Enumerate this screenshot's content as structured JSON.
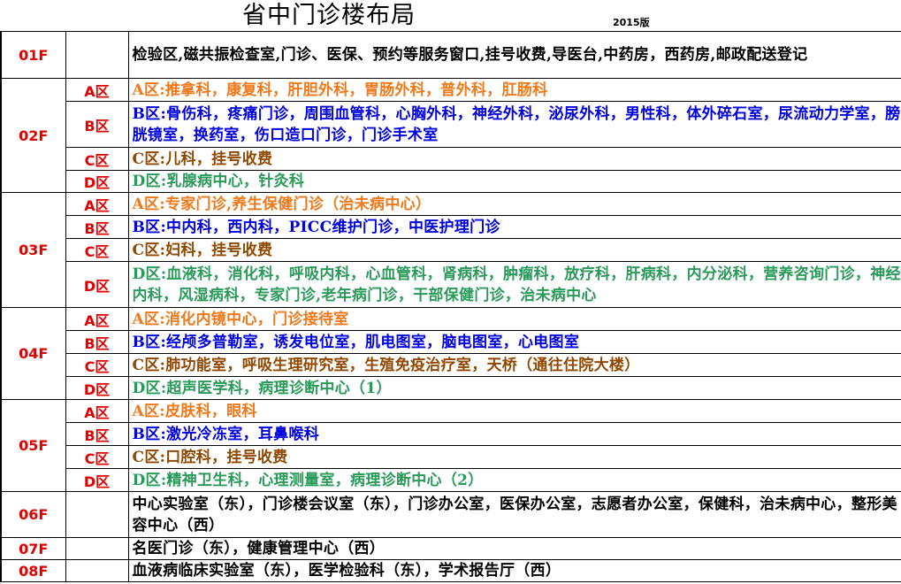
{
  "header": {
    "title": "省中门诊楼布局",
    "version": "2015版"
  },
  "floors": {
    "f01": {
      "label": "01F",
      "desc": "检验区,磁共振检查室,门诊、医保、预约等服务窗口,挂号收费,导医台,中药房，西药房,邮政配送登记"
    },
    "f02": {
      "label": "02F",
      "a": {
        "zone": "A区",
        "desc": "A区:推拿科，康复科，肝胆外科，胃肠外科，普外科，肛肠科"
      },
      "b": {
        "zone": "B区",
        "desc": "B区:骨伤科，疼痛门诊，周围血管科，心胸外科，神经外科，泌尿外科，男性科，体外碎石室，尿流动力学室，膀胱镜室，换药室，伤口造口门诊，门诊手术室"
      },
      "c": {
        "zone": "C区",
        "desc": "C区:儿科，挂号收费"
      },
      "d": {
        "zone": "D区",
        "desc": "D区:乳腺病中心，针灸科"
      }
    },
    "f03": {
      "label": "03F",
      "a": {
        "zone": "A区",
        "desc": "A区:专家门诊,养生保健门诊（治未病中心）"
      },
      "b": {
        "zone": "B区",
        "desc": "B区:中内科，西内科，PICC维护门诊，中医护理门诊"
      },
      "c": {
        "zone": "C区",
        "desc": "C区:妇科，挂号收费"
      },
      "d": {
        "zone": "D区",
        "desc": "D区:血液科，消化科，呼吸内科，心血管科，肾病科，肿瘤科，放疗科，肝病科，内分泌科，营养咨询门诊，神经内科，风湿病科，专家门诊,老年病门诊，干部保健门诊，治未病中心"
      }
    },
    "f04": {
      "label": "04F",
      "a": {
        "zone": "A区",
        "desc": "A区:消化内镜中心，门诊接待室"
      },
      "b": {
        "zone": "B区",
        "desc": "B区:经颅多普勒室，诱发电位室，肌电图室，脑电图室，心电图室"
      },
      "c": {
        "zone": "C区",
        "desc": "C区:肺功能室，呼吸生理研究室，生殖免疫治疗室，天桥（通往住院大楼）"
      },
      "d": {
        "zone": "D区",
        "desc": "D区:超声医学科，病理诊断中心（1）"
      }
    },
    "f05": {
      "label": "05F",
      "a": {
        "zone": "A区",
        "desc": "A区:皮肤科，眼科"
      },
      "b": {
        "zone": "B区",
        "desc": "B区:激光冷冻室，耳鼻喉科"
      },
      "c": {
        "zone": "C区",
        "desc": "C区:口腔科，挂号收费"
      },
      "d": {
        "zone": "D区",
        "desc": "D区:精神卫生科，心理测量室，病理诊断中心（2）"
      }
    },
    "f06": {
      "label": "06F",
      "desc": "中心实验室（东），门诊楼会议室（东），门诊办公室，医保办公室，志愿者办公室，保健科，治未病中心，整形美容中心（西）"
    },
    "f07": {
      "label": "07F",
      "desc": "名医门诊（东），健康管理中心（西）"
    },
    "f08": {
      "label": "08F",
      "desc": "血液病临床实验室（东），医学检验科（东），学术报告厅（西）"
    }
  },
  "colors": {
    "floor_label": "#e00000",
    "zone_a": "#f07818",
    "zone_b": "#0000e0",
    "zone_c": "#904800",
    "zone_d": "#2a9a5a"
  }
}
